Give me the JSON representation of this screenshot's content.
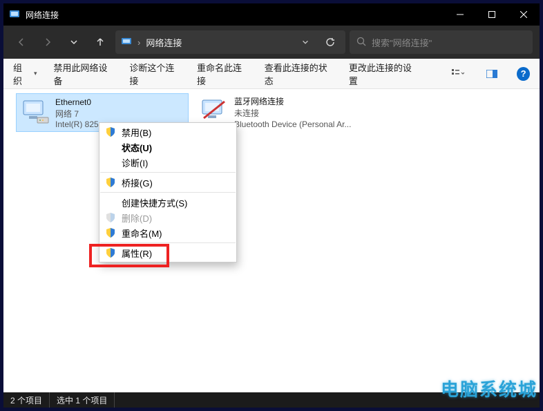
{
  "titlebar": {
    "title": "网络连接"
  },
  "address": {
    "crumb": "网络连接",
    "search_placeholder": "搜索\"网络连接\""
  },
  "commands": {
    "organize": "组织",
    "disable": "禁用此网络设备",
    "diagnose": "诊断这个连接",
    "rename": "重命名此连接",
    "viewstatus": "查看此连接的状态",
    "changesettings": "更改此连接的设置"
  },
  "adapters": {
    "eth": {
      "name": "Ethernet0",
      "network": "网络 7",
      "device": "Intel(R) 825…"
    },
    "bt": {
      "name": "蓝牙网络连接",
      "status": "未连接",
      "device": "Bluetooth Device (Personal Ar..."
    }
  },
  "ctx": {
    "disable": "禁用(B)",
    "status": "状态(U)",
    "diag": "诊断(I)",
    "bridge": "桥接(G)",
    "shortcut": "创建快捷方式(S)",
    "delete": "删除(D)",
    "rename": "重命名(M)",
    "props": "属性(R)"
  },
  "status": {
    "items": "2 个项目",
    "selected": "选中 1 个项目"
  },
  "watermark": "电脑系统城"
}
